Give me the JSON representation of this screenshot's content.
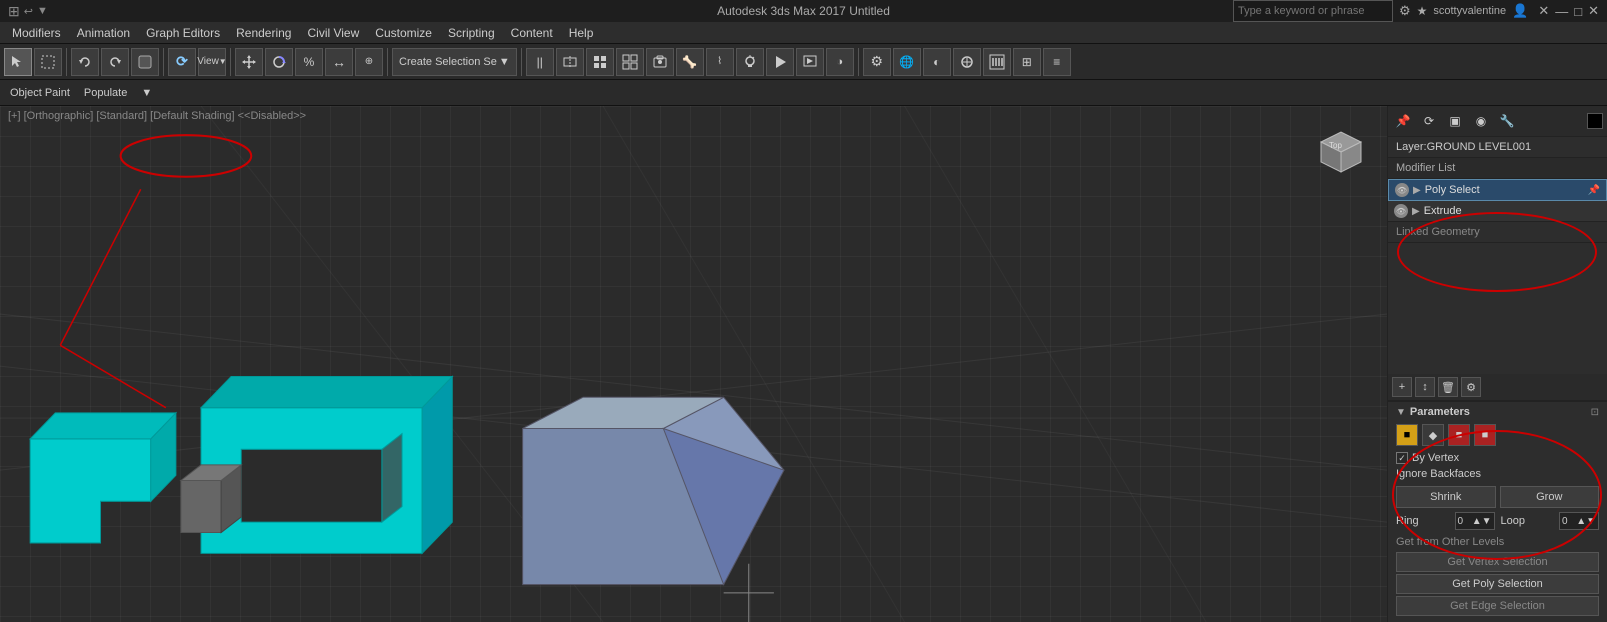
{
  "titlebar": {
    "title": "Autodesk 3ds Max 2017  Untitled",
    "search_placeholder": "Type a keyword or phrase",
    "user": "scottyvalentine",
    "min_label": "—",
    "max_label": "□",
    "close_label": "✕"
  },
  "menubar": {
    "items": [
      "Modifiers",
      "Animation",
      "Graph Editors",
      "Rendering",
      "Civil View",
      "Customize",
      "Scripting",
      "Content",
      "Help"
    ]
  },
  "toolbar": {
    "view_label": "View",
    "create_selection_label": "Create Selection Se",
    "create_selection_arrow": "▼"
  },
  "toolbar2": {
    "items": [
      "Object Paint",
      "Populate",
      "▼"
    ]
  },
  "viewport": {
    "header": "[+] [Orthographic] [Standard] [Default Shading]  <<Disabled>>"
  },
  "sidebar": {
    "layer_label": "Layer:GROUND LEVEL001",
    "modifier_list_label": "Modifier List",
    "modifiers": [
      {
        "name": "Poly Select",
        "active": true
      },
      {
        "name": "Extrude",
        "active": false
      },
      {
        "name": "Linked Geometry",
        "active": false
      }
    ],
    "params": {
      "title": "Parameters",
      "sel_icons": [
        "■",
        "◆",
        "■",
        "■"
      ],
      "by_vertex_label": "By Vertex",
      "ignore_backfaces_label": "Ignore Backfaces",
      "shrink_label": "Shrink",
      "grow_label": "Grow",
      "ring_label": "Ring",
      "loop_label": "Loop",
      "get_from_label": "Get from Other Levels",
      "get_vertex_label": "Get Vertex Selection",
      "get_poly_label": "Get Poly Selection",
      "get_edge_label": "Get Edge Selection"
    }
  }
}
